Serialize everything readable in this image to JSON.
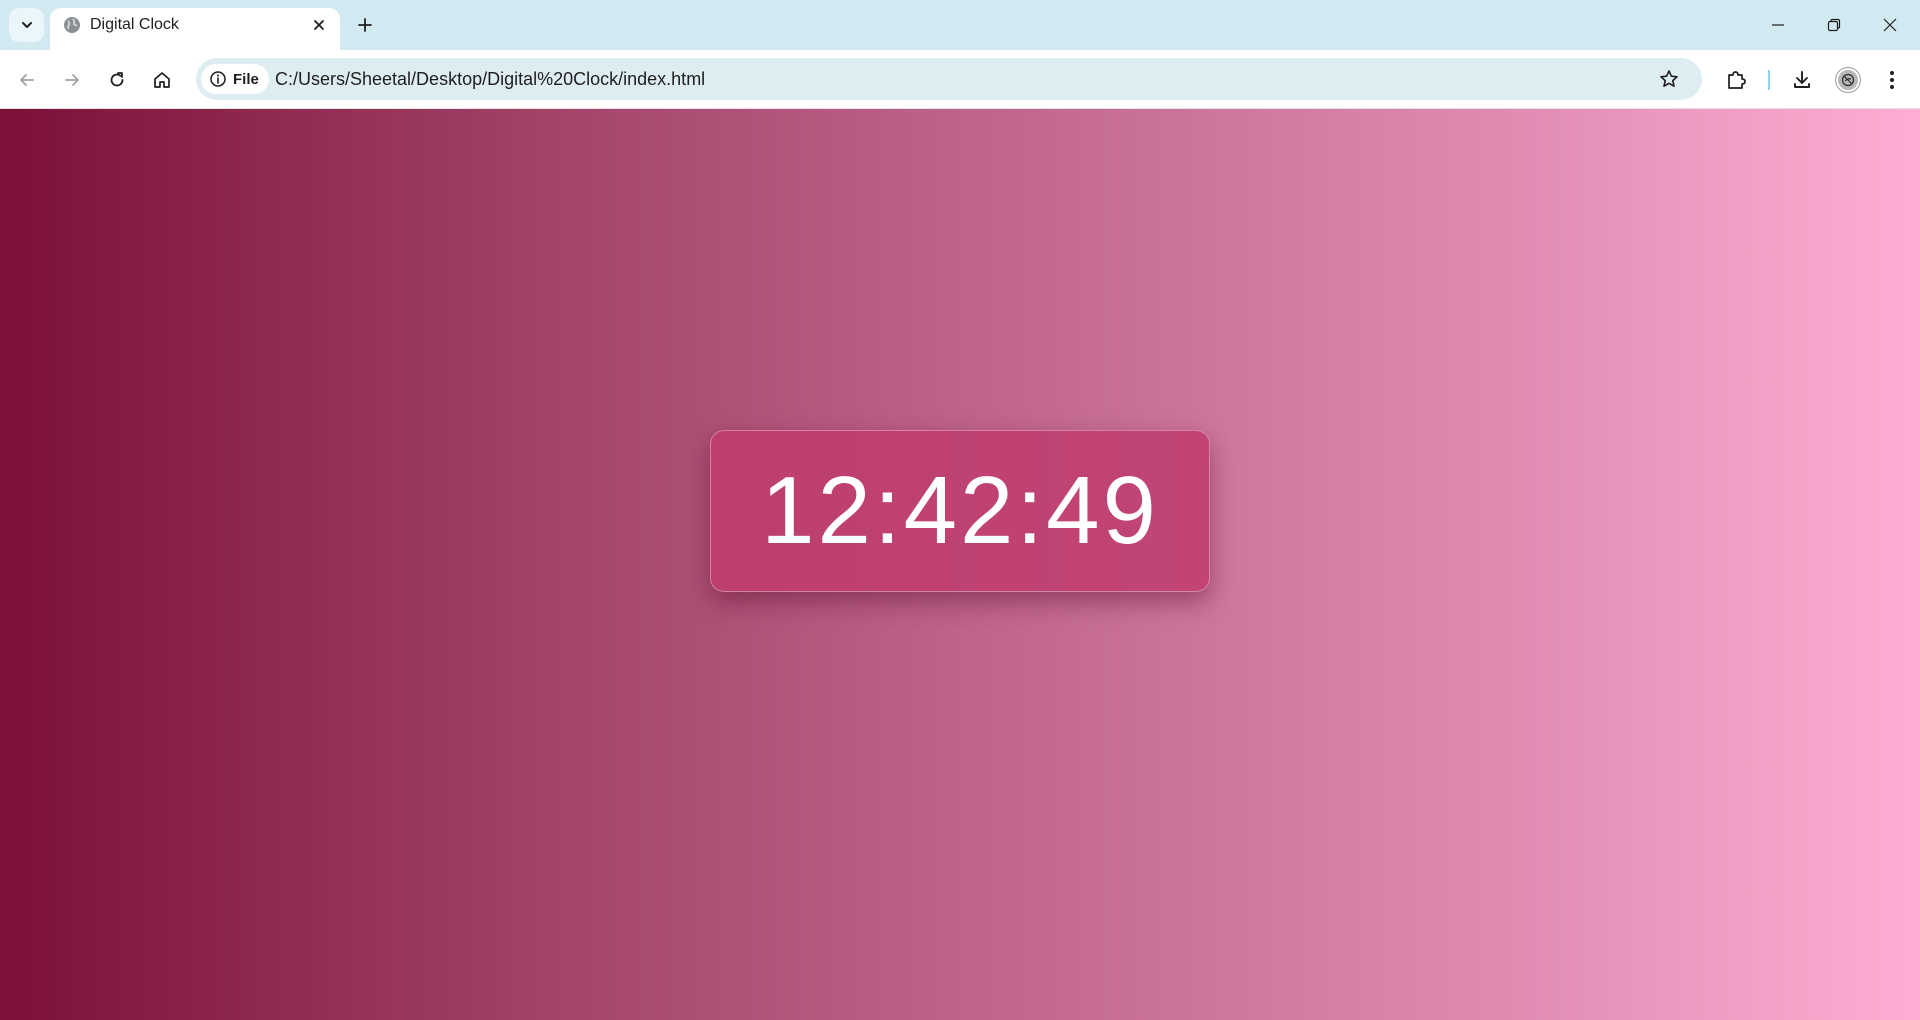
{
  "browser": {
    "tab": {
      "title": "Digital Clock"
    },
    "address_bar": {
      "scheme_chip": "File",
      "url": "C:/Users/Sheetal/Desktop/Digital%20Clock/index.html"
    },
    "icons": {
      "tab_search": "chevron-down-icon",
      "favicon": "globe-icon",
      "tab_close": "close-icon",
      "new_tab": "plus-icon",
      "minimize": "minimize-icon",
      "restore": "restore-icon",
      "close_window": "close-icon",
      "back": "back-arrow-icon",
      "forward": "forward-arrow-icon",
      "reload": "reload-icon",
      "home": "home-icon",
      "site_info": "info-icon",
      "bookmark": "star-icon",
      "extensions": "puzzle-icon",
      "downloads": "download-icon",
      "profile": "avatar",
      "menu": "kebab-menu-icon"
    }
  },
  "page": {
    "clock": {
      "time": "12:42:49"
    },
    "background_gradient": [
      "#7b1039",
      "#ffadd4"
    ],
    "card_color": "#be3c6e"
  }
}
